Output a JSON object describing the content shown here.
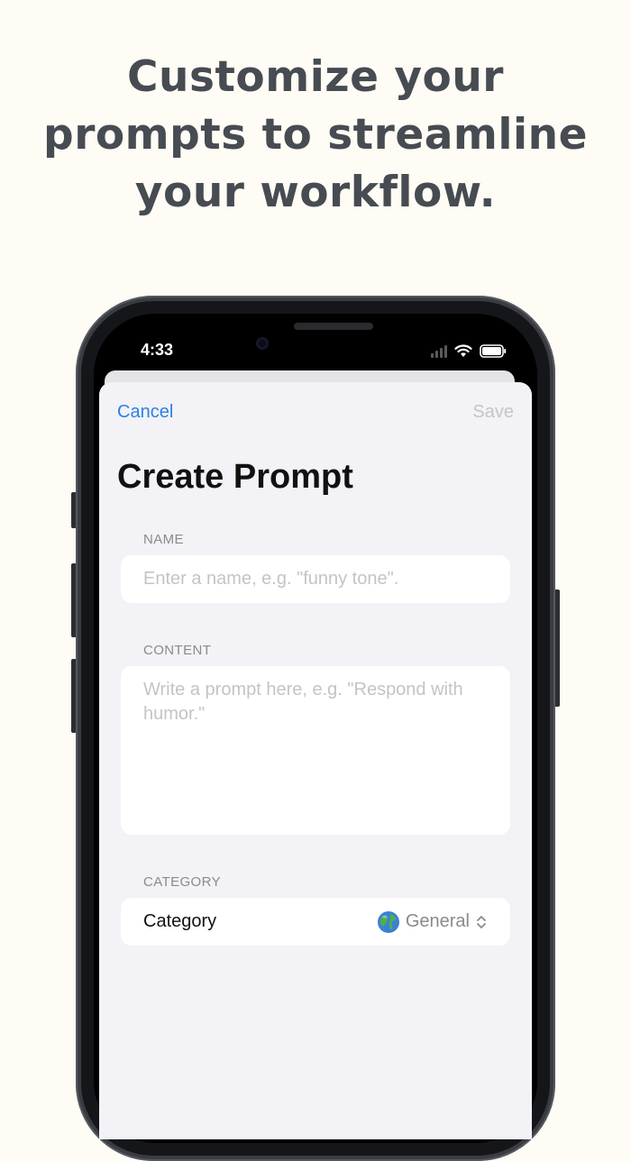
{
  "headline": {
    "line1": "Customize your",
    "line2": "prompts to streamline",
    "line3": "your workflow."
  },
  "status_bar": {
    "time": "4:33",
    "icons": [
      "cellular-signal-icon",
      "wifi-icon",
      "battery-icon"
    ]
  },
  "nav": {
    "cancel_label": "Cancel",
    "save_label": "Save",
    "title": "Create Prompt"
  },
  "form": {
    "name": {
      "label": "NAME",
      "value": "",
      "placeholder": "Enter a name, e.g. \"funny tone\"."
    },
    "content": {
      "label": "CONTENT",
      "value": "",
      "placeholder": "Write a prompt here, e.g. \"Respond with humor.\""
    },
    "category": {
      "section_label": "CATEGORY",
      "row_label": "Category",
      "selected_icon": "globe-icon",
      "selected_value": "General"
    }
  },
  "colors": {
    "background": "#fefcf4",
    "headline": "#474b52",
    "accent": "#2a82e4",
    "disabled": "#c5c5c9",
    "sheet": "#f2f2f7"
  }
}
